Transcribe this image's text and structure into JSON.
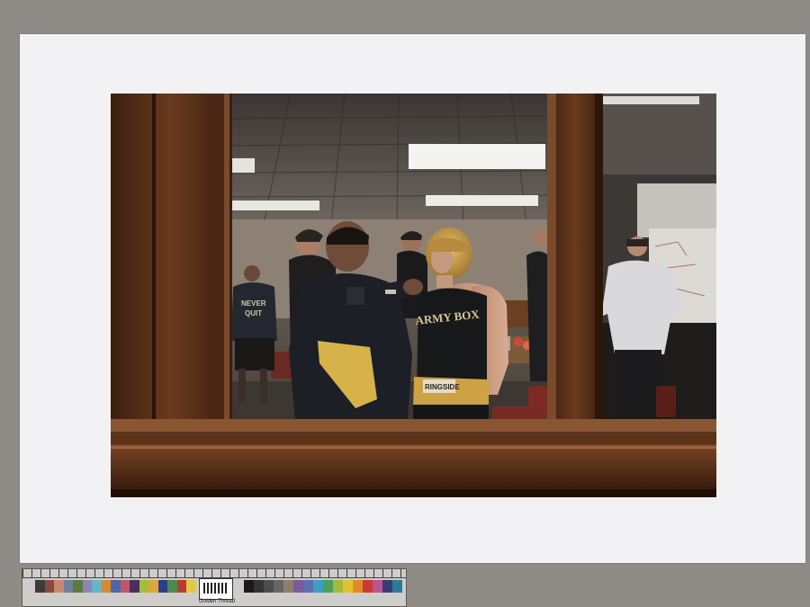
{
  "print": {
    "jersey_text": "ARMY BOX",
    "hoodie_text_line1": "NEVER",
    "hoodie_text_line2": "QUIT",
    "waistband_text": "RINGSIDE"
  },
  "color_target": {
    "brand_label": "Golden Thread",
    "left_patches": [
      "#3d3a38",
      "#8a4a3c",
      "#c9876f",
      "#6f7f9e",
      "#5c7a3c",
      "#8f84b3",
      "#65b6c6",
      "#d78a2e",
      "#5166a8",
      "#c0566a",
      "#4a2f5a",
      "#a3be3c",
      "#e0a63a",
      "#2c3d8e",
      "#4b8b48",
      "#b83a33",
      "#e4c93b",
      "#b7558f",
      "#3d8db5",
      "#ffffff",
      "#d8d8d8",
      "#b8b8b8",
      "#999999",
      "#7a7a7a",
      "#5a5a5a",
      "#3a3a3a",
      "#1a1a1a"
    ],
    "right_patches": [
      "#1a1a1a",
      "#333333",
      "#4d4d4d",
      "#666666",
      "#8c7f6d",
      "#7a5a9a",
      "#5c6fb5",
      "#3da0c0",
      "#4aa05a",
      "#a8b83a",
      "#e2c233",
      "#e08a2e",
      "#c83a34",
      "#b8558f",
      "#3a3a7a",
      "#2c7a9a"
    ]
  }
}
